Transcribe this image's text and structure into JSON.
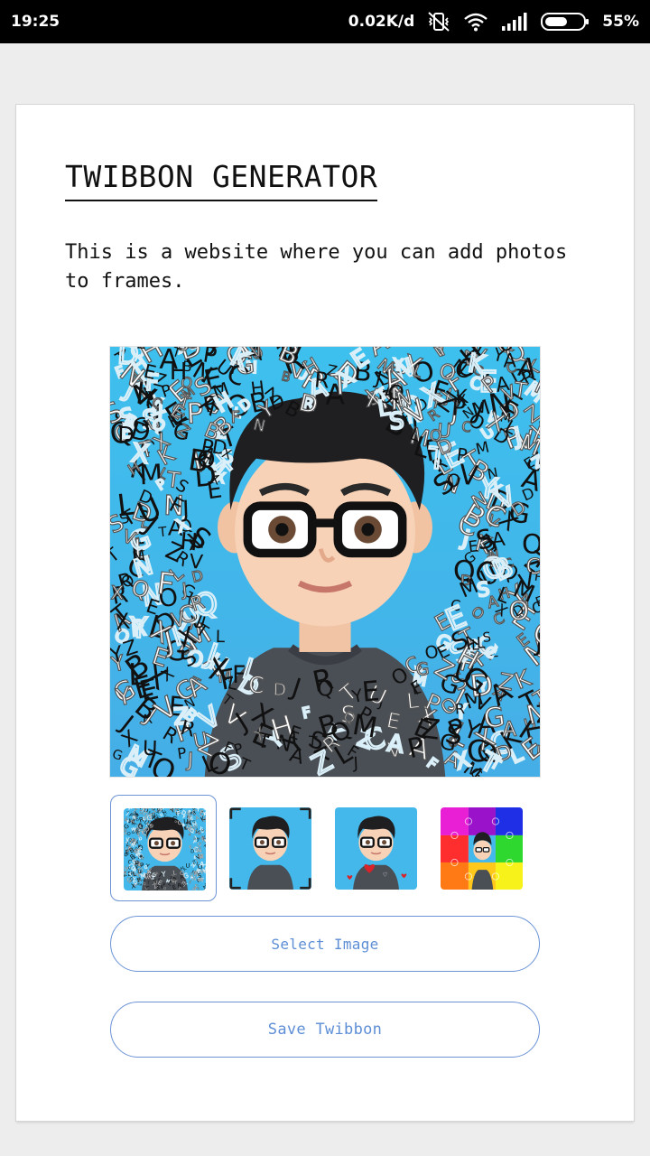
{
  "status_bar": {
    "time": "19:25",
    "network_speed": "0.02K/d",
    "battery_percent": "55%",
    "icons": [
      "vibrate-off-icon",
      "wifi-icon",
      "signal-icon",
      "battery-icon"
    ]
  },
  "page": {
    "title": "TWIBBON GENERATOR",
    "description": "This is a website where you can add photos to frames."
  },
  "thumbnails": [
    {
      "name": "letters-frame",
      "selected": true
    },
    {
      "name": "corner-frame",
      "selected": false
    },
    {
      "name": "hearts-frame",
      "selected": false
    },
    {
      "name": "puzzle-frame",
      "selected": false
    }
  ],
  "buttons": {
    "select_image": "Select Image",
    "save_twibbon": "Save Twibbon"
  },
  "colors": {
    "accent": "#6b93d6",
    "sky": "#46b7e8",
    "shirt": "#4a4e55"
  }
}
